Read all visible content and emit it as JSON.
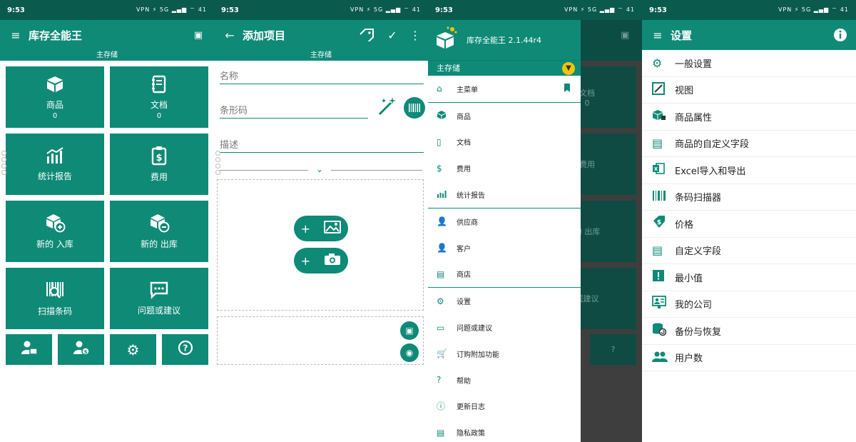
{
  "status": {
    "time": "9:53",
    "icons": "VPN ⚡ 5G ▂▄▆ ⌔ 41"
  },
  "colors": {
    "primary": "#0e8a77",
    "status": "#0b5a4e",
    "accent_yellow": "#f3c400"
  },
  "screen1": {
    "title": "库存全能王",
    "storage": "主存储",
    "tiles": [
      {
        "label": "商品",
        "count": "0",
        "icon": "box-icon"
      },
      {
        "label": "文档",
        "count": "0",
        "icon": "notebook-icon"
      },
      {
        "label": "统计报告",
        "icon": "chart-icon"
      },
      {
        "label": "费用",
        "icon": "invoice-icon"
      },
      {
        "label": "新的 入库",
        "icon": "box-plus-icon"
      },
      {
        "label": "新的 出库",
        "icon": "box-minus-icon"
      },
      {
        "label": "扫描条码",
        "icon": "barcode-scan-icon"
      },
      {
        "label": "问题或建议",
        "icon": "chat-icon"
      }
    ]
  },
  "screen2": {
    "title": "添加项目",
    "storage": "主存储",
    "name_placeholder": "名称",
    "barcode_placeholder": "条形码",
    "desc_placeholder": "描述",
    "plus": "+"
  },
  "screen3": {
    "drawer_title": "库存全能王 2.1.44r4",
    "storage": "主存储",
    "items": [
      {
        "label": "主菜单",
        "icon": "home-icon"
      },
      {
        "label": "商品",
        "icon": "box-icon"
      },
      {
        "label": "文档",
        "icon": "notebook-icon"
      },
      {
        "label": "费用",
        "icon": "invoice-icon"
      },
      {
        "label": "统计报告",
        "icon": "chart-icon"
      },
      {
        "label": "供应商",
        "icon": "supplier-icon"
      },
      {
        "label": "客户",
        "icon": "customer-icon"
      },
      {
        "label": "商店",
        "icon": "store-icon"
      },
      {
        "label": "设置",
        "icon": "gear-icon"
      },
      {
        "label": "问题或建议",
        "icon": "chat-icon"
      },
      {
        "label": "订购附加功能",
        "icon": "cart-icon"
      },
      {
        "label": "帮助",
        "icon": "help-icon"
      },
      {
        "label": "更新日志",
        "icon": "info-icon"
      },
      {
        "label": "隐私政策",
        "icon": "privacy-icon"
      }
    ],
    "behind_labels": [
      "文档",
      "0",
      "费用",
      "的 出库",
      "或建议"
    ]
  },
  "screen4": {
    "title": "设置",
    "items": [
      {
        "label": "一般设置",
        "icon": "gear-icon"
      },
      {
        "label": "视图",
        "icon": "view-icon"
      },
      {
        "label": "商品属性",
        "icon": "product-attr-icon"
      },
      {
        "label": "商品的自定义字段",
        "icon": "custom-field-icon"
      },
      {
        "label": "Excel导入和导出",
        "icon": "excel-icon"
      },
      {
        "label": "条码扫描器",
        "icon": "barcode-icon"
      },
      {
        "label": "价格",
        "icon": "price-icon"
      },
      {
        "label": "自定义字段",
        "icon": "fields-icon"
      },
      {
        "label": "最小值",
        "icon": "min-icon"
      },
      {
        "label": "我的公司",
        "icon": "company-icon"
      },
      {
        "label": "备份与恢复",
        "icon": "backup-icon"
      },
      {
        "label": "用户数",
        "icon": "users-icon"
      }
    ]
  }
}
